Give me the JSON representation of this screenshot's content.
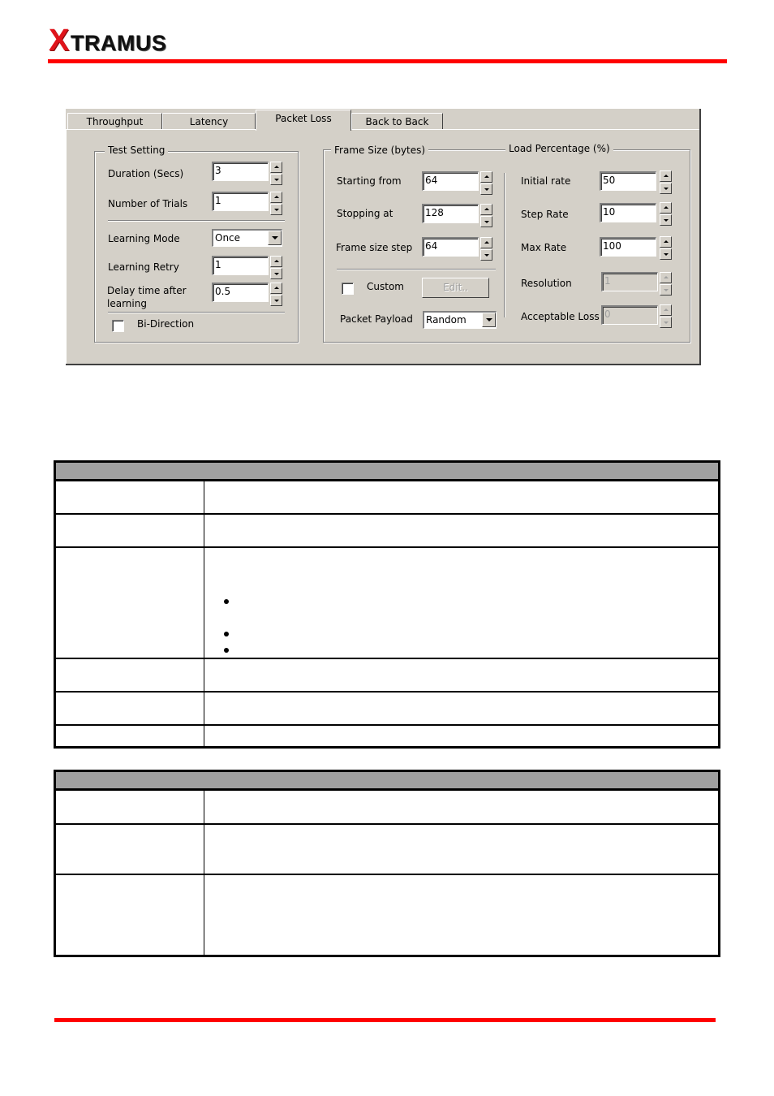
{
  "header": {
    "logo_first": "X",
    "logo_rest": "TRAMUS",
    "accent_color": "#ff0000"
  },
  "dialog": {
    "tabs": [
      {
        "label": "Throughput",
        "active": false
      },
      {
        "label": "Latency",
        "active": false
      },
      {
        "label": "Packet Loss",
        "active": true
      },
      {
        "label": "Back to Back",
        "active": false
      }
    ],
    "test_setting": {
      "title": "Test Setting",
      "duration": {
        "label": "Duration (Secs)",
        "value": "3"
      },
      "trials": {
        "label": "Number of Trials",
        "value": "1"
      },
      "learning_mode": {
        "label": "Learning Mode",
        "value": "Once"
      },
      "learning_retry": {
        "label": "Learning Retry",
        "value": "1"
      },
      "delay": {
        "label_line1": "Delay time after",
        "label_line2": "learning",
        "value": "0.5"
      },
      "bi_direction": {
        "label": "Bi-Direction",
        "checked": false
      }
    },
    "frame_size": {
      "title": "Frame Size  (bytes)",
      "starting_from": {
        "label": "Starting from",
        "value": "64"
      },
      "stopping_at": {
        "label": "Stopping at",
        "value": "128"
      },
      "frame_size_step": {
        "label": "Frame size step",
        "value": "64"
      },
      "custom": {
        "label": "Custom",
        "checked": false
      },
      "edit_button": "Edit..",
      "packet_payload": {
        "label": "Packet Payload",
        "value": "Random"
      }
    },
    "load_percentage": {
      "title": "Load Percentage (%)",
      "initial_rate": {
        "label": "Initial rate",
        "value": "50"
      },
      "step_rate": {
        "label": "Step Rate",
        "value": "10"
      },
      "max_rate": {
        "label": "Max Rate",
        "value": "100"
      },
      "resolution": {
        "label": "Resolution",
        "value": "1",
        "disabled": true
      },
      "acceptable_loss": {
        "label": "Acceptable Loss",
        "value": "0",
        "disabled": true
      }
    }
  },
  "tables": [
    {
      "header": "",
      "rows": [
        {
          "c1": "",
          "c2": "",
          "bullets": 0
        },
        {
          "c1": "",
          "c2": "",
          "bullets": 0
        },
        {
          "c1": "",
          "c2": "",
          "bullets": 3
        },
        {
          "c1": "",
          "c2": "",
          "bullets": 0
        },
        {
          "c1": "",
          "c2": "",
          "bullets": 0
        },
        {
          "c1": "",
          "c2": "",
          "bullets": 0
        }
      ]
    },
    {
      "header": "",
      "rows": [
        {
          "c1": "",
          "c2": "",
          "bullets": 0
        },
        {
          "c1": "",
          "c2": "",
          "bullets": 0
        },
        {
          "c1": "",
          "c2": "",
          "bullets": 0
        }
      ]
    }
  ]
}
